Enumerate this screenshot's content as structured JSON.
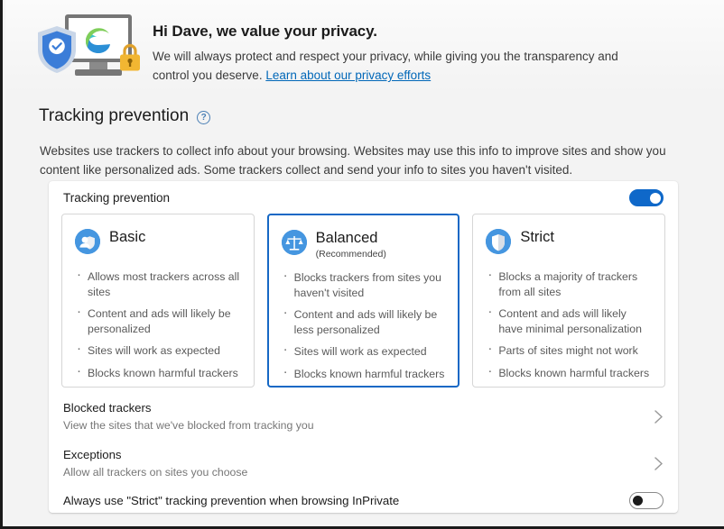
{
  "hero": {
    "title": "Hi Dave, we value your privacy.",
    "subtitle_line1": "We will always protect and respect your privacy, while giving you the transparency",
    "subtitle_line2_prefix": "and control you deserve. ",
    "link_text": "Learn about our privacy efforts",
    "art_icon": "privacy-shield-monitor-lock-illustration"
  },
  "section": {
    "title": "Tracking prevention",
    "help_icon": "help-question-icon",
    "description": "Websites use trackers to collect info about your browsing. Websites may use this info to improve sites and show you content like personalized ads. Some trackers collect and send your info to sites you haven't visited."
  },
  "card": {
    "toggle_label": "Tracking prevention",
    "toggle_state": "on",
    "levels": [
      {
        "id": "basic",
        "name": "Basic",
        "recommended_label": "",
        "selected": false,
        "icon": "basic-tracker-shield-icon",
        "bullets": [
          "Allows most trackers across all sites",
          "Content and ads will likely be personalized",
          "Sites will work as expected",
          "Blocks known harmful trackers"
        ]
      },
      {
        "id": "balanced",
        "name": "Balanced",
        "recommended_label": "(Recommended)",
        "selected": true,
        "icon": "balance-scales-icon",
        "bullets": [
          "Blocks trackers from sites you haven't visited",
          "Content and ads will likely be less personalized",
          "Sites will work as expected",
          "Blocks known harmful trackers"
        ]
      },
      {
        "id": "strict",
        "name": "Strict",
        "recommended_label": "",
        "selected": false,
        "icon": "strict-shield-icon",
        "bullets": [
          "Blocks a majority of trackers from all sites",
          "Content and ads will likely have minimal personalization",
          "Parts of sites might not work",
          "Blocks known harmful trackers"
        ]
      }
    ],
    "rows": [
      {
        "id": "blocked-trackers",
        "title": "Blocked trackers",
        "subtitle": "View the sites that we've blocked from tracking you",
        "chevron": "chevron-right-icon"
      },
      {
        "id": "exceptions",
        "title": "Exceptions",
        "subtitle": "Allow all trackers on sites you choose",
        "chevron": "chevron-right-icon"
      }
    ],
    "inprivate": {
      "label": "Always use \"Strict\" tracking prevention when browsing InPrivate",
      "toggle_state": "off"
    }
  },
  "colors": {
    "accent_blue": "#0f68c9",
    "selected_border": "#1668c5",
    "link_blue": "#0067b8",
    "icon_blue": "#4596e0",
    "page_bg": "#f3f3f3",
    "card_bg": "#ffffff"
  }
}
